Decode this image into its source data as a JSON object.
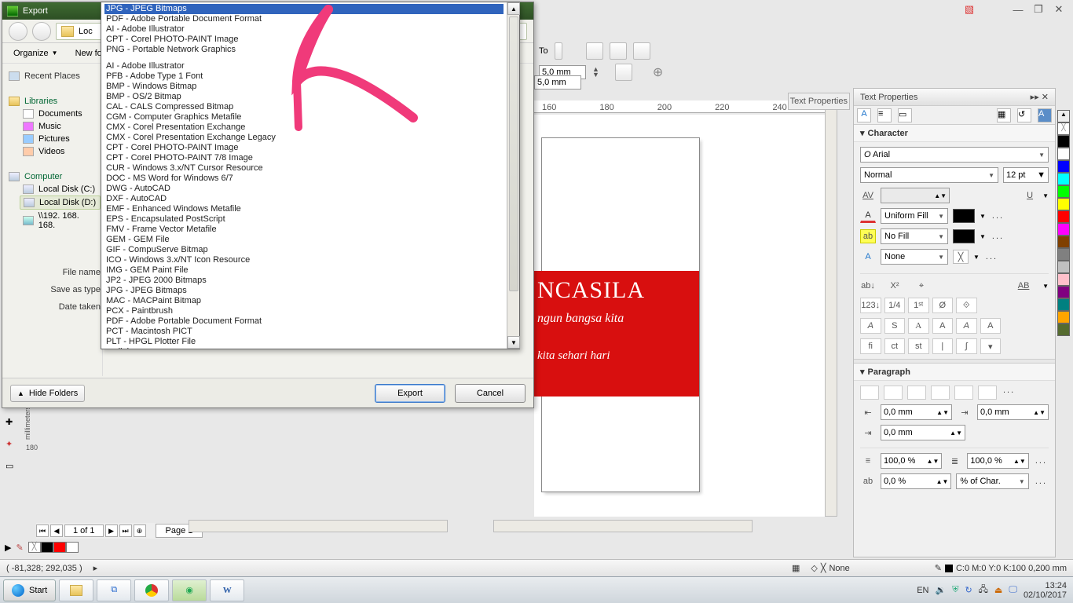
{
  "app": {
    "window_controls": {
      "min": "—",
      "max": "❐",
      "close": "✕"
    },
    "extra_icon": "▧"
  },
  "options_bar": {
    "to_label": "To",
    "width_val": "5,0 mm",
    "height_val": "5,0 mm",
    "plus": "⊕"
  },
  "ruler": {
    "ticks": [
      "",
      "160",
      "180",
      "200",
      "220",
      "240"
    ],
    "units": "millimeters"
  },
  "banner": {
    "title": "NCASILA",
    "line2": "ngun bangsa kita",
    "line3": "kita sehari hari"
  },
  "page_nav": {
    "first": "⏮",
    "prev": "◀",
    "label": "1 of 1",
    "next": "▶",
    "last": "⏭",
    "add": "⊕",
    "tab": "Page 1"
  },
  "vertical_ruler_label": "millimeters",
  "vertical_ruler_tick": "180",
  "color_swatches": [
    "#ffffff00",
    "#000000",
    "#ff0000",
    "#ffffff"
  ],
  "status": {
    "coords": "( -81,328; 292,035 )",
    "cursor_icon": "▸",
    "fill_icon": "◇",
    "fill_x": "╳",
    "fill_label": "None",
    "pen_icon": "✎",
    "outline": "C:0 M:0 Y:0 K:100  0,200 mm"
  },
  "taskbar": {
    "start": "Start",
    "lang": "EN",
    "time": "13:24",
    "date": "02/10/2017"
  },
  "docker": {
    "title": "Text Properties",
    "side_tab": "Text Properties",
    "section_char": "Character",
    "font": "Arial",
    "font_style": "Normal",
    "font_size": "12 pt",
    "kerning_icon": "AV",
    "underline_icon": "U",
    "fill_type": "Uniform Fill",
    "bg_fill": "No Fill",
    "outline_type": "None",
    "outline_x": "╳",
    "dots": "...",
    "ab_sub": "ab↓",
    "x_sup": "X²",
    "target": "⌖",
    "AB_u": "AB",
    "r123": "123↓",
    "frac": "1/4",
    "first": "1ˢᵗ",
    "zero": "Ø",
    "link": "⟐",
    "glyph_row": [
      "A",
      "S",
      "A",
      "A",
      "A",
      "A"
    ],
    "feat_row": [
      "fi",
      "ct",
      "st",
      "|",
      "∫",
      ""
    ],
    "section_para": "Paragraph",
    "indent_left": "0,0 mm",
    "indent_right": "0,0 mm",
    "indent_first": "0,0 mm",
    "pct1": "100,0 %",
    "pct2": "100,0 %",
    "char_spacing_val": "0,0 %",
    "char_spacing_lbl": "% of Char."
  },
  "palette": [
    "#000",
    "#fff",
    "#00f",
    "#0ff",
    "#0f0",
    "#ff0",
    "#f00",
    "#f0f",
    "#804000",
    "#808080",
    "#c0c0c0",
    "#ffc0cb",
    "#800080",
    "#008080",
    "#ffa500",
    "#556b2f"
  ],
  "export": {
    "title": "Export",
    "addr_text": "Loc",
    "organize": "Organize",
    "new_folder": "New fol",
    "places": {
      "recent": "Recent Places",
      "libraries": "Libraries",
      "documents": "Documents",
      "music": "Music",
      "pictures": "Pictures",
      "videos": "Videos",
      "computer": "Computer",
      "disk_c": "Local Disk (C:)",
      "disk_d": "Local Disk (D:)",
      "net_path": "\\\\192. 168. 168."
    },
    "labels": {
      "file_name": "File name:",
      "save_type": "Save as type:",
      "date_taken": "Date taken:"
    },
    "buttons": {
      "hide": "Hide Folders",
      "export": "Export",
      "cancel": "Cancel"
    }
  },
  "type_dropdown": {
    "group1": [
      "JPG - JPEG Bitmaps",
      "PDF - Adobe Portable Document Format",
      "AI - Adobe Illustrator",
      "CPT - Corel PHOTO-PAINT Image",
      "PNG - Portable Network Graphics"
    ],
    "group2": [
      "AI - Adobe Illustrator",
      "PFB - Adobe Type 1 Font",
      "BMP - Windows Bitmap",
      "BMP - OS/2 Bitmap",
      "CAL - CALS Compressed Bitmap",
      "CGM - Computer Graphics Metafile",
      "CMX - Corel Presentation Exchange",
      "CMX - Corel Presentation Exchange Legacy",
      "CPT - Corel PHOTO-PAINT Image",
      "CPT - Corel PHOTO-PAINT 7/8 Image",
      "CUR - Windows 3.x/NT Cursor Resource",
      "DOC - MS Word for Windows 6/7",
      "DWG - AutoCAD",
      "DXF - AutoCAD",
      "EMF - Enhanced Windows Metafile",
      "EPS - Encapsulated PostScript",
      "FMV - Frame Vector Metafile",
      "GEM - GEM File",
      "GIF - CompuServe Bitmap",
      "ICO - Windows 3.x/NT Icon Resource",
      "IMG - GEM Paint File",
      "JP2 - JPEG 2000 Bitmaps",
      "JPG - JPEG Bitmaps",
      "MAC - MACPaint Bitmap",
      "PCX - Paintbrush",
      "PDF - Adobe Portable Document Format",
      "PCT - Macintosh PICT",
      "PLT - HPGL Plotter File"
    ],
    "footer": "dialog"
  }
}
